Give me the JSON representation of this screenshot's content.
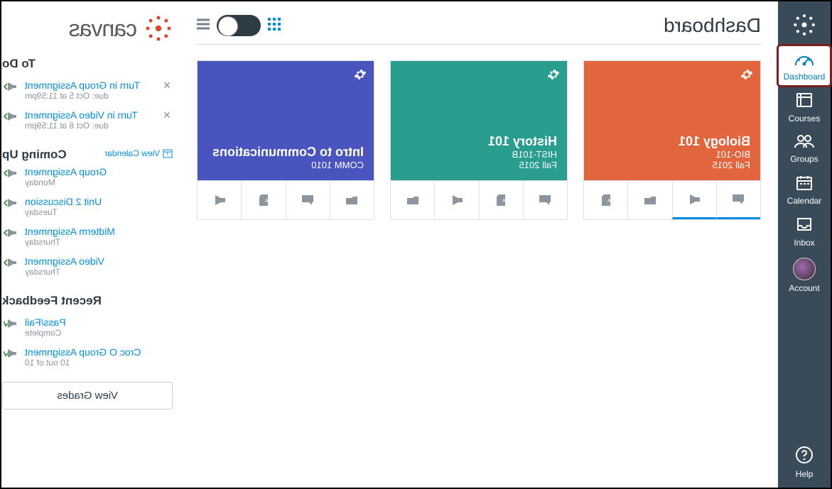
{
  "nav": {
    "items": [
      {
        "label": "Dashboard"
      },
      {
        "label": "Courses"
      },
      {
        "label": "Groups"
      },
      {
        "label": "Calendar"
      },
      {
        "label": "Inbox"
      },
      {
        "label": "Account"
      },
      {
        "label": "Help"
      }
    ]
  },
  "header": {
    "title": "Dashboard"
  },
  "brand": {
    "text": "canvas"
  },
  "colors": {
    "card1": "#e1663e",
    "card2": "#2a9e8e",
    "card3": "#4a54bf"
  },
  "courses": [
    {
      "title": "Biology 101",
      "code": "BIO-101",
      "term": "2015 Fall"
    },
    {
      "title": "History 101",
      "code": "HIST-101B",
      "term": "2015 Fall"
    },
    {
      "title": "Intro to Communications",
      "code": "COMM 1010",
      "term": ""
    }
  ],
  "sidebar": {
    "todo": {
      "title": "To Do",
      "items": [
        {
          "title": "Turn in Group Assignment",
          "due": "due: Oct 5 at 11:59pm"
        },
        {
          "title": "Turn in Video Assignment",
          "due": "due: Oct 8 at 11:59pm"
        }
      ]
    },
    "coming_up": {
      "title": "Coming Up",
      "view_calendar": "View Calendar",
      "items": [
        {
          "title": "Group Assignment",
          "meta": "Monday"
        },
        {
          "title": "Unit 2 Discussion",
          "meta": "Tuesday"
        },
        {
          "title": "Midterm Assignment",
          "meta": "Thursday"
        },
        {
          "title": "Video Assignment",
          "meta": "Thursday"
        }
      ]
    },
    "recent_feedback": {
      "title": "Recent Feedback",
      "items": [
        {
          "title": "Pass/Fail",
          "meta": "Complete"
        },
        {
          "title": "Croc O Group Assignment",
          "meta": "10 out of 10"
        }
      ]
    },
    "view_grades": "View Grades"
  }
}
